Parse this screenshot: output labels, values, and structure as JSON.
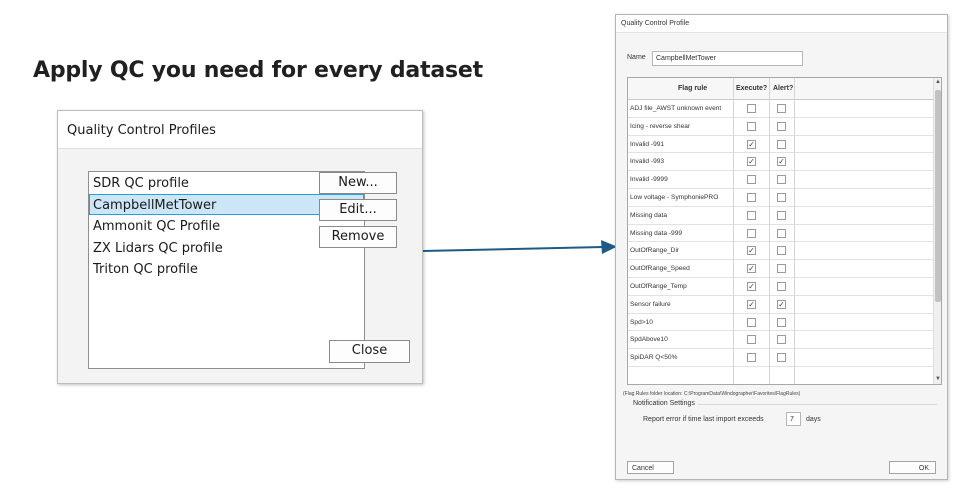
{
  "headline": "Apply QC you need for every dataset",
  "profiles_dialog": {
    "title": "Quality Control Profiles",
    "items": [
      {
        "label": "SDR QC profile",
        "selected": false
      },
      {
        "label": "CampbellMetTower",
        "selected": true
      },
      {
        "label": "Ammonit QC Profile",
        "selected": false
      },
      {
        "label": "ZX Lidars QC profile",
        "selected": false
      },
      {
        "label": "Triton QC profile",
        "selected": false
      }
    ],
    "new_label": "New...",
    "edit_label": "Edit...",
    "remove_label": "Remove",
    "close_label": "Close"
  },
  "profile_dialog": {
    "title": "Quality Control Profile",
    "name_label": "Name",
    "name_value": "CampbellMetTower",
    "columns": [
      "Flag rule",
      "Execute?",
      "Alert?"
    ],
    "rules": [
      {
        "name": "ADJ file_AWST unknown event",
        "execute": false,
        "alert": false
      },
      {
        "name": "Icing - reverse shear",
        "execute": false,
        "alert": false
      },
      {
        "name": "Invalid -991",
        "execute": true,
        "alert": false
      },
      {
        "name": "Invalid -993",
        "execute": true,
        "alert": true
      },
      {
        "name": "Invalid -9999",
        "execute": false,
        "alert": false
      },
      {
        "name": "Low voltage - SymphoniePRO",
        "execute": false,
        "alert": false
      },
      {
        "name": "Missing data",
        "execute": false,
        "alert": false
      },
      {
        "name": "Missing data -999",
        "execute": false,
        "alert": false
      },
      {
        "name": "OutOfRange_Dir",
        "execute": true,
        "alert": false
      },
      {
        "name": "OutOfRange_Speed",
        "execute": true,
        "alert": false
      },
      {
        "name": "OutOfRange_Temp",
        "execute": true,
        "alert": false
      },
      {
        "name": "Sensor failure",
        "execute": true,
        "alert": true
      },
      {
        "name": "Spd>10",
        "execute": false,
        "alert": false
      },
      {
        "name": "SpdAbove10",
        "execute": false,
        "alert": false
      },
      {
        "name": "SpiDAR Q<50%",
        "execute": false,
        "alert": false
      }
    ],
    "folder_note": "(Flag Rules folder location: C:\\ProgramData\\Windographer\\Favorites\\FlagRules)",
    "notification_heading": "Notification Settings",
    "report_label": "Report error if time last import exceeds",
    "report_value": "7",
    "report_unit": "days",
    "cancel_label": "Cancel",
    "ok_label": "OK"
  },
  "colors": {
    "arrow": "#1f5a84",
    "selection_bg": "#cde6f7",
    "selection_border": "#26a0da"
  }
}
